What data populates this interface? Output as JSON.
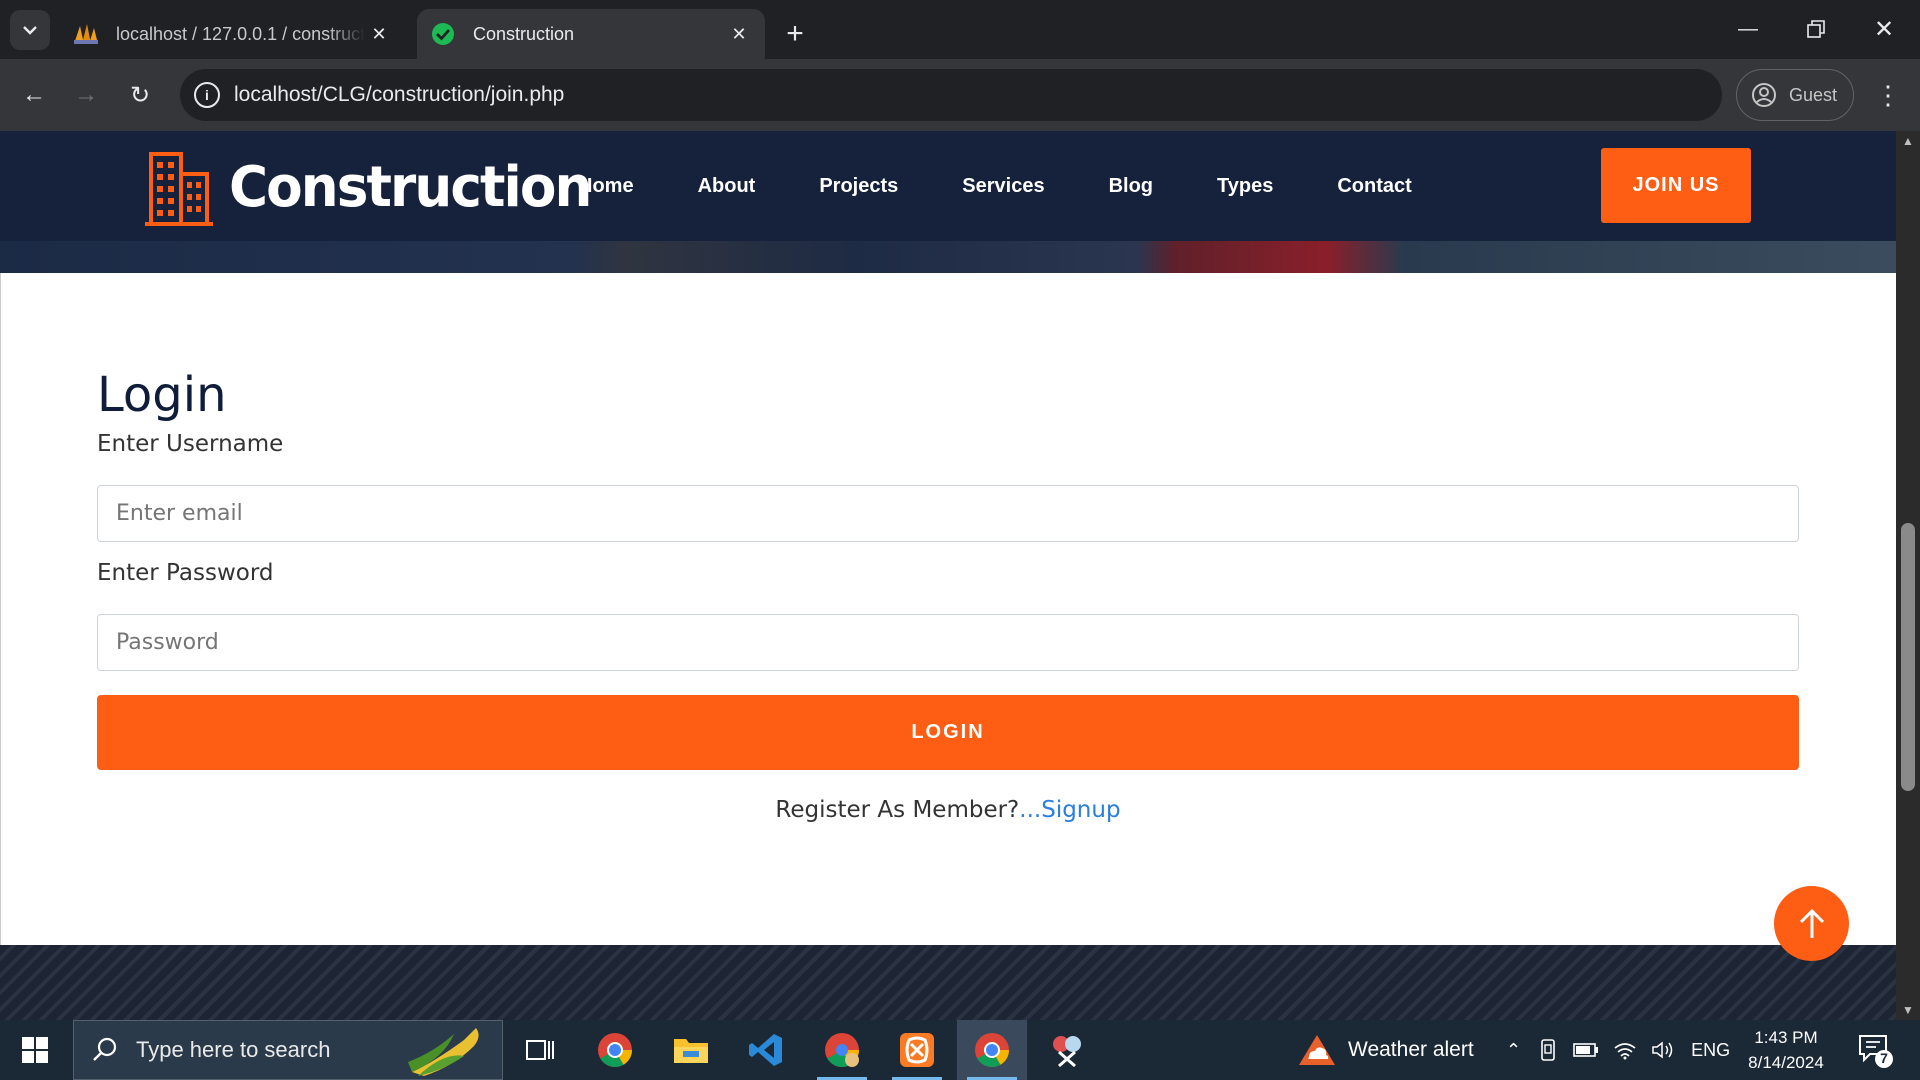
{
  "browser": {
    "tabs": [
      {
        "title": "localhost / 127.0.0.1 / construct",
        "active": false
      },
      {
        "title": "Construction",
        "active": true
      }
    ],
    "url": "localhost/CLG/construction/join.php",
    "profile_label": "Guest"
  },
  "site": {
    "brand": "Construction",
    "nav": [
      "Home",
      "About",
      "Projects",
      "Services",
      "Blog",
      "Types",
      "Contact"
    ],
    "join_label": "JOIN US",
    "accent_color": "#fe5d14",
    "navbar_color": "#16213b"
  },
  "login": {
    "title": "Login",
    "username_label": "Enter Username",
    "username_placeholder": "Enter email",
    "password_label": "Enter Password",
    "password_placeholder": "Password",
    "button_label": "LOGIN",
    "register_text": "Register As Member?",
    "signup_link": "...Signup"
  },
  "taskbar": {
    "search_placeholder": "Type here to search",
    "weather": "Weather alert",
    "language": "ENG",
    "time": "1:43 PM",
    "date": "8/14/2024",
    "notification_count": "7"
  }
}
